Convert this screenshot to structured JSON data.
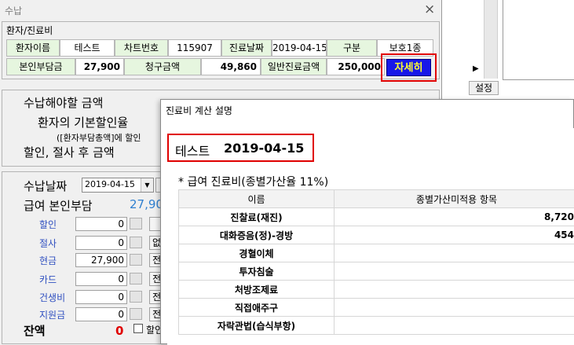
{
  "main_window": {
    "title": "수납",
    "close_glyph": "×",
    "patient_group_label": "환자/진료비",
    "row1": {
      "name_label": "환자이름",
      "name_value": "테스트",
      "chart_label": "차트번호",
      "chart_value": "115907",
      "date_label": "진료날짜",
      "date_value": "2019-04-15",
      "type_label": "구분",
      "type_value": "보호1종"
    },
    "row2": {
      "self_label": "본인부담금",
      "self_value": "27,900",
      "claim_label": "청구금액",
      "claim_value": "49,860",
      "general_label": "일반진료금액",
      "general_value": "250,000",
      "detail_button": "자세히"
    },
    "scroll_arrow": "▶",
    "settings_button": "설정",
    "payable_label": "수납해야할 금액",
    "discount_rate_label": "환자의 기본할인율",
    "discount_note": "([환자부담총액]에 할인",
    "after_discount_label": "할인, 절사 후 금액",
    "payment_date_label": "수납날짜",
    "payment_date_value": "2019-04-15",
    "benefit_self_label": "급여 본인부담",
    "benefit_self_value": "27,90",
    "payment_rows": [
      {
        "label": "할인",
        "value": "0",
        "extra": ""
      },
      {
        "label": "절사",
        "value": "0",
        "extra": "없"
      },
      {
        "label": "현금",
        "value": "27,900",
        "extra": "전"
      },
      {
        "label": "카드",
        "value": "0",
        "extra": "전"
      },
      {
        "label": "건생비",
        "value": "0",
        "extra": "전"
      },
      {
        "label": "지원금",
        "value": "0",
        "extra": "전"
      }
    ],
    "balance_label": "잔액",
    "balance_value": "0",
    "balance_check_label": "할인"
  },
  "dialog": {
    "title": "진료비 계산 설명",
    "patient_name": "테스트",
    "date": "2019-04-15",
    "section_title": "* 급여 진료비(종별가산율 11%)",
    "col_name": "이름",
    "col_item": "종별가산미적용 항목",
    "rows": [
      {
        "name": "진찰료(재진)",
        "value": "8,720"
      },
      {
        "name": "대화증음(정)-경방",
        "value": "454"
      },
      {
        "name": "경혈이체",
        "value": ""
      },
      {
        "name": "투자침술",
        "value": ""
      },
      {
        "name": "처방조제료",
        "value": ""
      },
      {
        "name": "직접애주구",
        "value": ""
      },
      {
        "name": "자락관법(습식부항)",
        "value": ""
      }
    ]
  },
  "colors": {
    "label_green": "#e6f6df",
    "detail_button_bg": "#1818e8",
    "detail_button_text": "#ffff30",
    "highlight_red": "#e00000",
    "amount_blue": "#3080d0",
    "label_blue": "#3050c0"
  }
}
